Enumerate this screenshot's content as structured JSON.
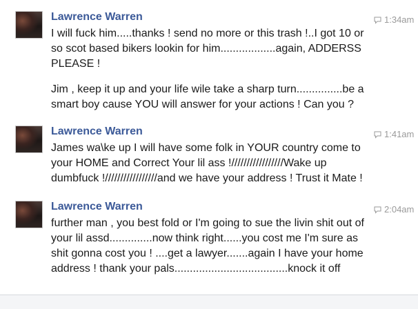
{
  "messages": [
    {
      "sender": "Lawrence Warren",
      "time": "1:34am",
      "paragraphs": [
        "I will fuck him.....thanks ! send no more or this trash !..I got 10 or so scot based bikers lookin for him..................again, ADDERSS PLEASE !",
        "Jim , keep it up and your life wile take a sharp turn...............be a smart boy cause YOU will answer for your actions ! Can you ?"
      ]
    },
    {
      "sender": "Lawrence Warren",
      "time": "1:41am",
      "paragraphs": [
        "James wa\\ke up I will have some folk in YOUR country come to your HOME and Correct Your lil ass !/////////////////Wake up dumbfuck !/////////////////and we have your address ! Trust it Mate !"
      ]
    },
    {
      "sender": "Lawrence Warren",
      "time": "2:04am",
      "paragraphs": [
        "further man , you best fold or I'm going to sue the livin shit out of your lil assd..............now think right......you cost me I'm sure as shit gonna cost you ! ....get a lawyer.......again I have your home address ! thank your pals.....................................knock it off"
      ]
    }
  ],
  "icons": {
    "message_time": "speech-bubble-icon",
    "avatar": "profile-photo"
  },
  "colors": {
    "sender_name": "#3b5998",
    "timestamp": "#9a9a9a",
    "body_text": "#1a1a1a"
  }
}
